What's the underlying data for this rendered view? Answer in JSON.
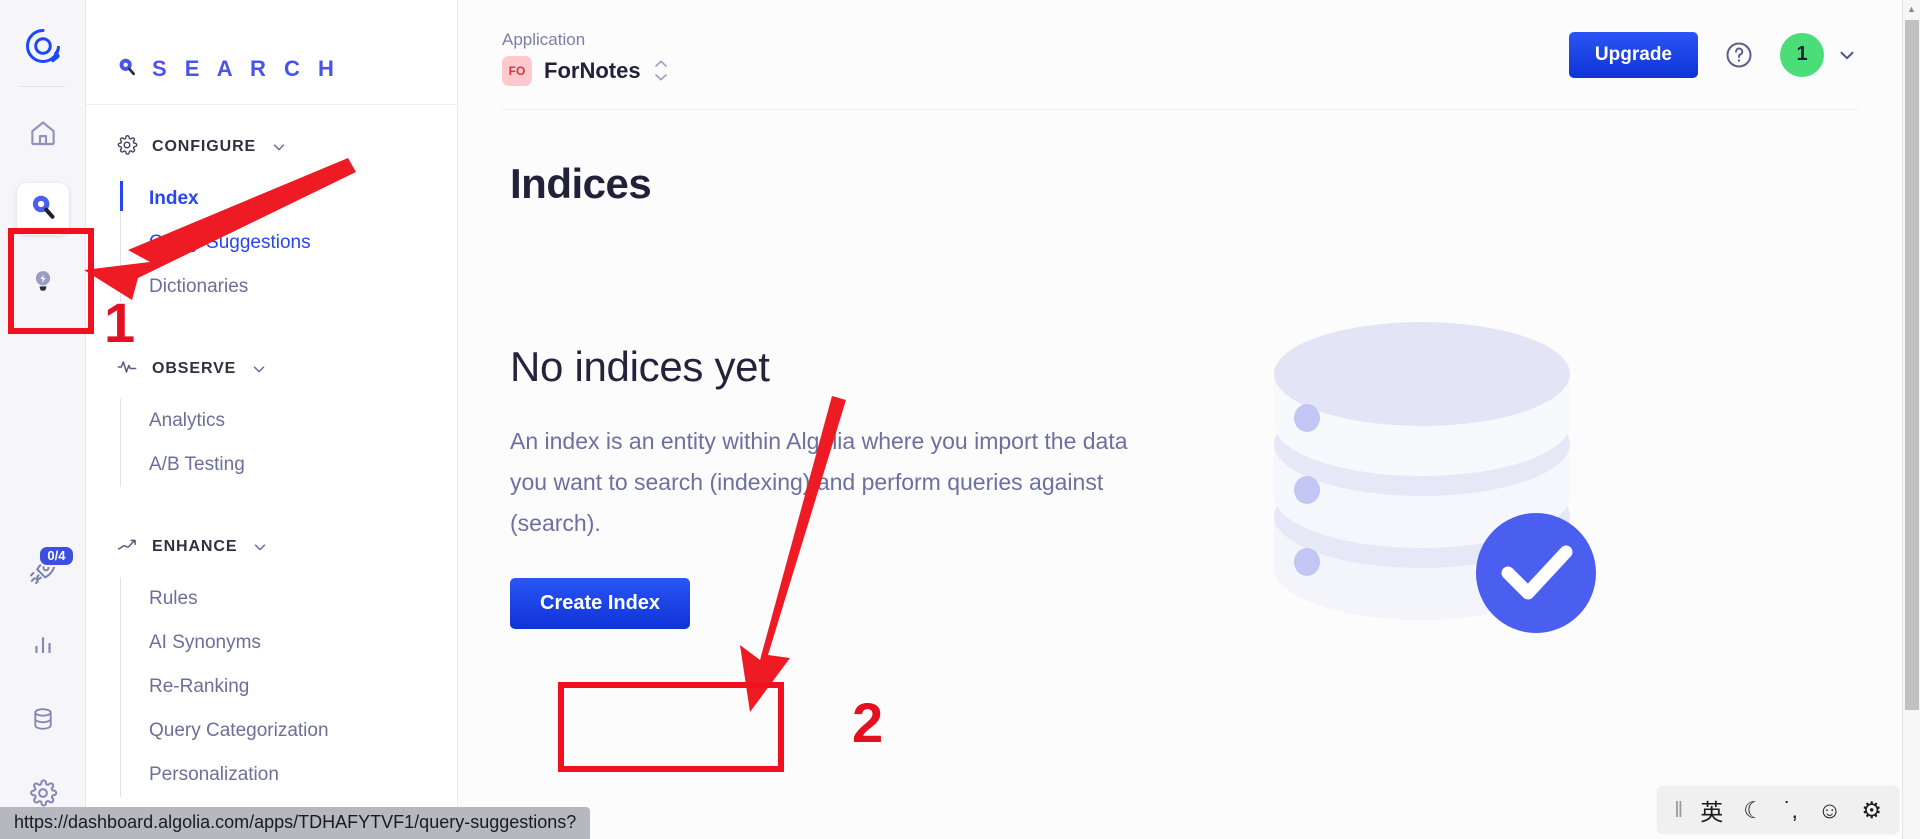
{
  "rail": {
    "logo": "algolia-logo",
    "items": [
      {
        "name": "home-icon",
        "label": "Home"
      },
      {
        "name": "search-icon",
        "label": "Search",
        "active": true
      },
      {
        "name": "lightbulb-icon",
        "label": "Ideas"
      }
    ],
    "bottom_items": [
      {
        "name": "rocket-icon",
        "label": "Onboarding",
        "badge": "0/4"
      },
      {
        "name": "bar-chart-icon",
        "label": "Analytics"
      },
      {
        "name": "database-icon",
        "label": "Data Sources"
      },
      {
        "name": "gear-icon",
        "label": "Settings"
      }
    ]
  },
  "sidebar": {
    "brand": "S E A R C H",
    "groups": [
      {
        "title": "CONFIGURE",
        "icon": "gear-icon",
        "items": [
          {
            "label": "Index",
            "state": "active"
          },
          {
            "label": "Query Suggestions",
            "state": "linked"
          },
          {
            "label": "Dictionaries",
            "state": "normal"
          }
        ]
      },
      {
        "title": "OBSERVE",
        "icon": "pulse-icon",
        "items": [
          {
            "label": "Analytics",
            "state": "normal"
          },
          {
            "label": "A/B Testing",
            "state": "normal"
          }
        ]
      },
      {
        "title": "ENHANCE",
        "icon": "trend-up-icon",
        "items": [
          {
            "label": "Rules",
            "state": "normal"
          },
          {
            "label": "AI Synonyms",
            "state": "normal"
          },
          {
            "label": "Re-Ranking",
            "state": "normal"
          },
          {
            "label": "Query Categorization",
            "state": "normal"
          },
          {
            "label": "Personalization",
            "state": "normal"
          }
        ]
      }
    ]
  },
  "topbar": {
    "application_label": "Application",
    "application_initials": "FO",
    "application_name": "ForNotes",
    "upgrade_label": "Upgrade",
    "help_icon": "question-circle-icon",
    "user_initial": "1"
  },
  "main": {
    "page_title": "Indices",
    "empty_heading": "No indices yet",
    "empty_body": "An index is an entity within Algolia where you import the data you want to search (indexing) and perform queries against (search).",
    "create_label": "Create Index",
    "illustration": "database-stack-with-check-illustration"
  },
  "annotations": {
    "step1": "1",
    "step2": "2"
  },
  "statusbar": {
    "url": "https://dashboard.algolia.com/apps/TDHAFYTVF1/query-suggestions?"
  },
  "ime": {
    "grip": "‖",
    "items": [
      {
        "name": "ime-language-toggle",
        "glyph": "英"
      },
      {
        "name": "ime-moon-icon",
        "glyph": "☾"
      },
      {
        "name": "ime-punctuation-icon",
        "glyph": "˙,"
      },
      {
        "name": "ime-emoji-icon",
        "glyph": "☺"
      },
      {
        "name": "ime-settings-icon",
        "glyph": "⚙"
      }
    ]
  },
  "colors": {
    "accent_blue": "#2546f0",
    "brand_blue": "#4a54e8",
    "annotation_red": "#f20f1e",
    "avatar_green": "#4bdd78",
    "app_badge_pink": "#ffc9cd"
  }
}
